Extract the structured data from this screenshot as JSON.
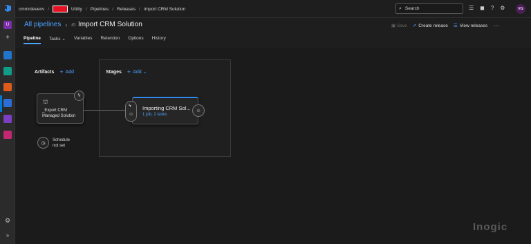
{
  "topbar": {
    "breadcrumbs": [
      "cmmrdevenv",
      "Utility",
      "Pipelines",
      "Releases",
      "Import CRM Solution"
    ],
    "search_placeholder": "Search",
    "avatar_initials": "VG"
  },
  "left_rail": {
    "org_initial": "U"
  },
  "header": {
    "all_pipelines": "All pipelines",
    "pipeline_title": "Import CRM Solution"
  },
  "actions": {
    "save": "Save",
    "create_release": "Create release",
    "view_releases": "View releases",
    "more": "···"
  },
  "tabs": [
    {
      "label": "Pipeline",
      "active": true
    },
    {
      "label": "Tasks ⌄",
      "active": false
    },
    {
      "label": "Variables",
      "active": false
    },
    {
      "label": "Retention",
      "active": false
    },
    {
      "label": "Options",
      "active": false
    },
    {
      "label": "History",
      "active": false
    }
  ],
  "artifacts": {
    "heading": "Artifacts",
    "add_label": "Add",
    "card_name_line1": "_Export CRM",
    "card_name_line2": "Managed Solution"
  },
  "schedule": {
    "line1": "Schedule",
    "line2": "not set"
  },
  "stages": {
    "heading": "Stages",
    "add_label": "Add",
    "stage_name": "Importing CRM Sol...",
    "stage_sub": "1 job, 2 tasks"
  },
  "watermark": "Inogic",
  "colors": {
    "accent": "#4da3ff",
    "stage_bar": "#2f8bf0",
    "background": "#1e1e1e",
    "redaction": "#e81123"
  }
}
